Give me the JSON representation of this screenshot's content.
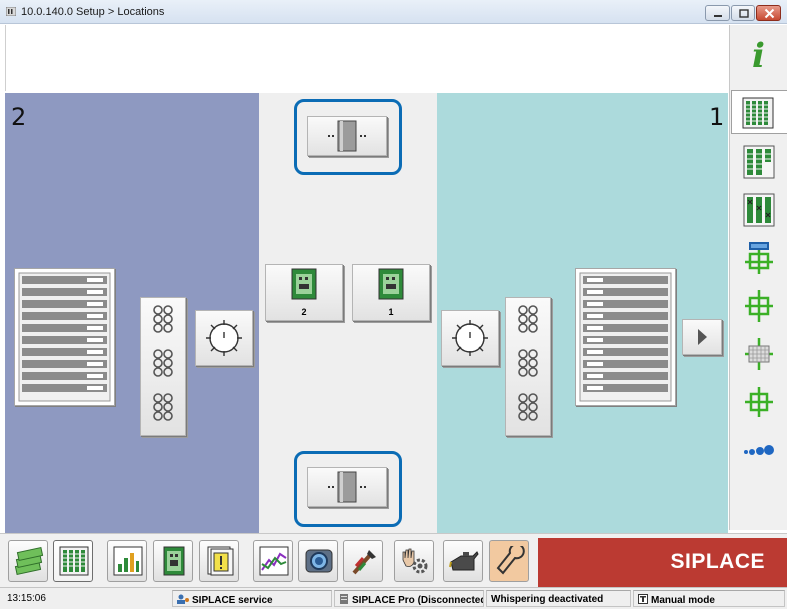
{
  "window": {
    "title": "10.0.140.0 Setup > Locations"
  },
  "lines": {
    "left_number": "2",
    "right_number": "1"
  },
  "tables": {
    "table_2_label": "2",
    "table_1_label": "1"
  },
  "sidebar": {
    "items": [
      {
        "icon": "info-icon"
      },
      {
        "icon": "setup-grid-icon",
        "selected": true
      },
      {
        "icon": "setup-list-icon"
      },
      {
        "icon": "setup-check-icon"
      },
      {
        "icon": "pcb-camera-icon"
      },
      {
        "icon": "pcb-icon"
      },
      {
        "icon": "pcb-grid-icon"
      },
      {
        "icon": "pcb-target-icon"
      },
      {
        "icon": "more-dots-icon"
      }
    ]
  },
  "toolbar": {
    "buttons": [
      {
        "icon": "money-stack-icon"
      },
      {
        "icon": "setup-grid-icon",
        "active": true
      },
      {
        "icon": "bar-chart-icon"
      },
      {
        "icon": "pcb-icon"
      },
      {
        "icon": "warning-doc-icon"
      },
      {
        "icon": "line-graph-icon"
      },
      {
        "icon": "camera-icon"
      },
      {
        "icon": "tools-icon"
      },
      {
        "icon": "hand-gear-icon"
      },
      {
        "icon": "oil-can-icon"
      },
      {
        "icon": "service-wrench-icon"
      }
    ],
    "brand": "SIPLACE"
  },
  "statusbar": {
    "time": "13:15:06",
    "service": "SIPLACE service",
    "pro": "SIPLACE Pro (Disconnected)",
    "whispering": "Whispering deactivated",
    "mode": "Manual mode"
  },
  "colors": {
    "line2_bg": "#8e99c1",
    "line1_bg": "#acdadc",
    "highlight": "#0b6cb5",
    "brand": "#bb3a32"
  }
}
